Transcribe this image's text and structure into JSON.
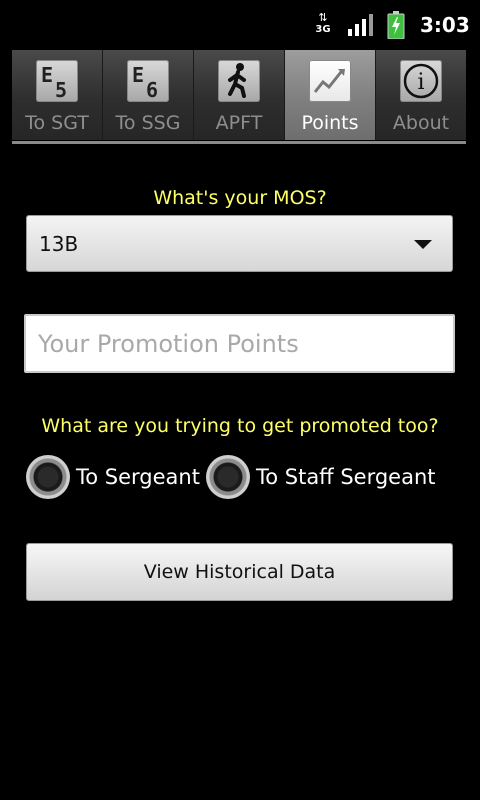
{
  "status_bar": {
    "network_type": "3G",
    "time": "3:03",
    "icons": [
      "data-transfer-icon",
      "signal-icon",
      "battery-charging-icon"
    ]
  },
  "tabs": [
    {
      "label": "To SGT",
      "icon": "e5-rank-icon",
      "icon_letter": "E",
      "icon_digit": "5",
      "selected": false
    },
    {
      "label": "To SSG",
      "icon": "e6-rank-icon",
      "icon_letter": "E",
      "icon_digit": "6",
      "selected": false
    },
    {
      "label": "APFT",
      "icon": "walking-person-icon",
      "selected": false
    },
    {
      "label": "Points",
      "icon": "line-chart-icon",
      "selected": true
    },
    {
      "label": "About",
      "icon": "info-icon",
      "icon_text": "i",
      "selected": false
    }
  ],
  "form": {
    "mos_prompt": "What's your MOS?",
    "mos_value": "13B",
    "points_placeholder": "Your Promotion Points",
    "points_value": "",
    "promotion_prompt": "What are you trying to get promoted too?",
    "radio_options": [
      {
        "label": "To Sergeant",
        "checked": false
      },
      {
        "label": "To Staff Sergeant",
        "checked": false
      }
    ],
    "history_button_label": "View Historical Data"
  },
  "colors": {
    "prompt_text": "#ffff66",
    "background": "#000000",
    "tab_selected": "#8a8a8a",
    "tab_unselected": "#333333"
  }
}
